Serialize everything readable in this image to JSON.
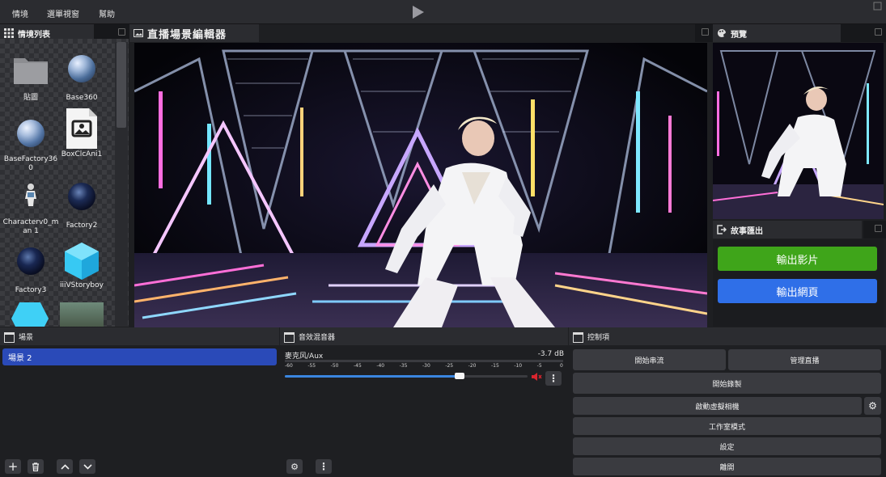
{
  "menu": {
    "items": [
      "情境",
      "選單視窗",
      "幫助"
    ]
  },
  "scene_list": {
    "title": "情境列表",
    "assets": [
      {
        "label": "貼圖",
        "icon": "folder-icon"
      },
      {
        "label": "Base360",
        "icon": "sphere-icon"
      },
      {
        "label": "BaseFactory360",
        "icon": "sphere-icon"
      },
      {
        "label": "BoxClcAni1",
        "icon": "image-file-icon"
      },
      {
        "label": "Characterv0_man 1",
        "icon": "character-icon"
      },
      {
        "label": "Factory2",
        "icon": "sphere-icon"
      },
      {
        "label": "Factory3",
        "icon": "sphere-icon"
      },
      {
        "label": "iiiVStoryboy",
        "icon": "cube-icon"
      }
    ]
  },
  "editor": {
    "title": "直播場景編輯器"
  },
  "preview": {
    "title": "預覽"
  },
  "story_export": {
    "title": "故事匯出",
    "export_video": "輸出影片",
    "export_web": "輸出網頁",
    "colors": {
      "video": "#3fa51a",
      "web": "#2f6fe8"
    }
  },
  "scenes": {
    "title": "場景",
    "items": [
      "場景 2"
    ],
    "selected_color": "#2a4ab8"
  },
  "mixer": {
    "title": "音效混音器",
    "channel_name": "麥克风/Aux",
    "level": "-3.7 dB",
    "ticks": [
      "-60",
      "-55",
      "-50",
      "-45",
      "-40",
      "-35",
      "-30",
      "-25",
      "-20",
      "-15",
      "-10",
      "-5",
      "0"
    ],
    "volume_fraction": 0.72
  },
  "controls": {
    "title": "控制項",
    "start_stream": "開始串流",
    "manage_stream": "管理直播",
    "start_record": "開始錄製",
    "start_virtual_cam": "啟動虛擬相機",
    "studio_mode": "工作室模式",
    "settings": "設定",
    "exit": "離開"
  }
}
